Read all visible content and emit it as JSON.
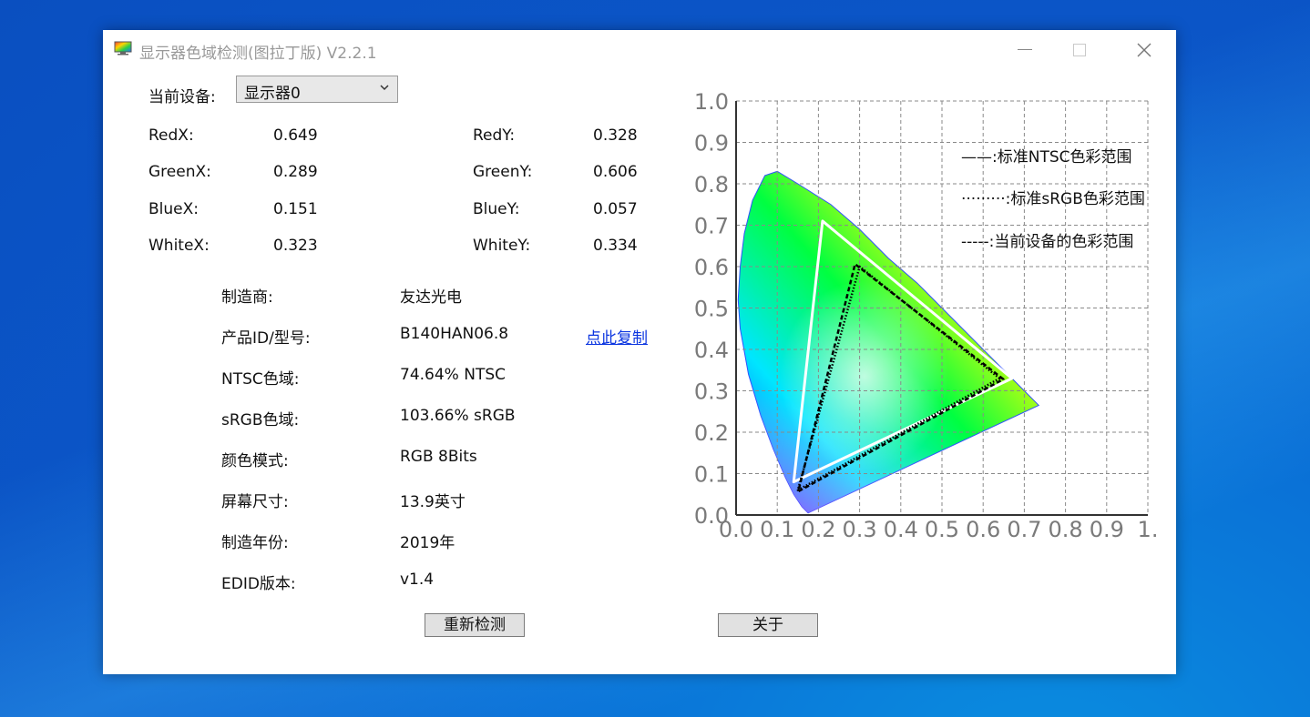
{
  "window": {
    "title": "显示器色域检测(图拉丁版) V2.2.1"
  },
  "device": {
    "label": "当前设备:",
    "selected": "显示器0"
  },
  "coords": [
    {
      "xlabel": "RedX:",
      "xvalue": "0.649",
      "ylabel": "RedY:",
      "yvalue": "0.328"
    },
    {
      "xlabel": "GreenX:",
      "xvalue": "0.289",
      "ylabel": "GreenY:",
      "yvalue": "0.606"
    },
    {
      "xlabel": "BlueX:",
      "xvalue": "0.151",
      "ylabel": "BlueY:",
      "yvalue": "0.057"
    },
    {
      "xlabel": "WhiteX:",
      "xvalue": "0.323",
      "ylabel": "WhiteY:",
      "yvalue": "0.334"
    }
  ],
  "info": [
    {
      "label": "制造商:",
      "value": "友达光电"
    },
    {
      "label": "产品ID/型号:",
      "value": "B140HAN06.8"
    },
    {
      "label": "NTSC色域:",
      "value": "74.64% NTSC"
    },
    {
      "label": "sRGB色域:",
      "value": "103.66% sRGB"
    },
    {
      "label": "颜色模式:",
      "value": "RGB 8Bits"
    },
    {
      "label": "屏幕尺寸:",
      "value": "13.9英寸"
    },
    {
      "label": "制造年份:",
      "value": "2019年"
    },
    {
      "label": "EDID版本:",
      "value": "v1.4"
    }
  ],
  "copy_link": "点此复制",
  "buttons": {
    "redetect": "重新检测",
    "about": "关于"
  },
  "chart_data": {
    "type": "scatter",
    "xlim": [
      0,
      1
    ],
    "ylim": [
      0,
      1
    ],
    "grid": true,
    "xticks": [
      "0.0",
      "0.1",
      "0.2",
      "0.3",
      "0.4",
      "0.5",
      "0.6",
      "0.7",
      "0.8",
      "0.9",
      "1."
    ],
    "yticks": [
      "0.0",
      "0.1",
      "0.2",
      "0.3",
      "0.4",
      "0.5",
      "0.6",
      "0.7",
      "0.8",
      "0.9",
      "1.0"
    ],
    "legend_position": "top-right",
    "legend": [
      "——:标准NTSC色彩范围",
      "·········:标准sRGB色彩范围",
      "-----:当前设备的色彩范围"
    ],
    "series": [
      {
        "style": "solid",
        "color": "#ffffff",
        "points": [
          [
            0.67,
            0.33
          ],
          [
            0.21,
            0.71
          ],
          [
            0.14,
            0.08
          ]
        ]
      },
      {
        "style": "dotted",
        "color": "#000000",
        "points": [
          [
            0.64,
            0.33
          ],
          [
            0.3,
            0.6
          ],
          [
            0.15,
            0.06
          ]
        ]
      },
      {
        "style": "dashed",
        "color": "#000000",
        "points": [
          [
            0.649,
            0.328
          ],
          [
            0.289,
            0.606
          ],
          [
            0.151,
            0.057
          ]
        ]
      }
    ],
    "locus": [
      [
        0.175,
        0.005
      ],
      [
        0.16,
        0.02
      ],
      [
        0.14,
        0.05
      ],
      [
        0.12,
        0.09
      ],
      [
        0.09,
        0.16
      ],
      [
        0.06,
        0.24
      ],
      [
        0.03,
        0.34
      ],
      [
        0.01,
        0.45
      ],
      [
        0.005,
        0.52
      ],
      [
        0.01,
        0.6
      ],
      [
        0.02,
        0.68
      ],
      [
        0.04,
        0.76
      ],
      [
        0.07,
        0.82
      ],
      [
        0.1,
        0.83
      ],
      [
        0.15,
        0.8
      ],
      [
        0.23,
        0.75
      ],
      [
        0.3,
        0.69
      ],
      [
        0.37,
        0.62
      ],
      [
        0.44,
        0.56
      ],
      [
        0.52,
        0.48
      ],
      [
        0.6,
        0.4
      ],
      [
        0.67,
        0.33
      ],
      [
        0.735,
        0.265
      ]
    ]
  }
}
